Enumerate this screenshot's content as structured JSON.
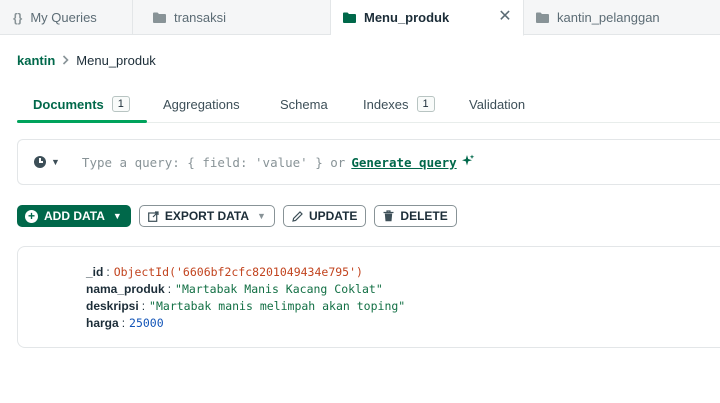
{
  "tabs": [
    {
      "icon": "curly-braces-icon",
      "label": "My Queries"
    },
    {
      "icon": "folder-icon",
      "label": "transaksi"
    },
    {
      "icon": "folder-icon",
      "label": "Menu_produk",
      "active": true
    },
    {
      "icon": "folder-icon",
      "label": "kantin_pelanggan"
    }
  ],
  "breadcrumb": {
    "database": "kantin",
    "collection": "Menu_produk"
  },
  "subtabs": {
    "documents": {
      "label": "Documents",
      "count": "1"
    },
    "aggregations": {
      "label": "Aggregations"
    },
    "schema": {
      "label": "Schema"
    },
    "indexes": {
      "label": "Indexes",
      "count": "1"
    },
    "validation": {
      "label": "Validation"
    }
  },
  "query": {
    "placeholder": "Type a query: { field: 'value' } or",
    "generate_label": "Generate query"
  },
  "toolbar": {
    "add_data": "ADD DATA",
    "export_data": "EXPORT DATA",
    "update": "UPDATE",
    "delete": "DELETE"
  },
  "document": {
    "id": {
      "key": "_id",
      "value": "ObjectId('6606bf2cfc8201049434e795')"
    },
    "nama_produk": {
      "key": "nama_produk",
      "value": "\"Martabak Manis Kacang Coklat\""
    },
    "deskripsi": {
      "key": "deskripsi",
      "value": "\"Martabak manis melimpah akan toping\""
    },
    "harga": {
      "key": "harga",
      "value": "25000"
    }
  },
  "colors": {
    "accent": "#00684a",
    "active_underline": "#00a35c",
    "objectid": "#c2441f",
    "string": "#137045",
    "number": "#1254b7"
  }
}
